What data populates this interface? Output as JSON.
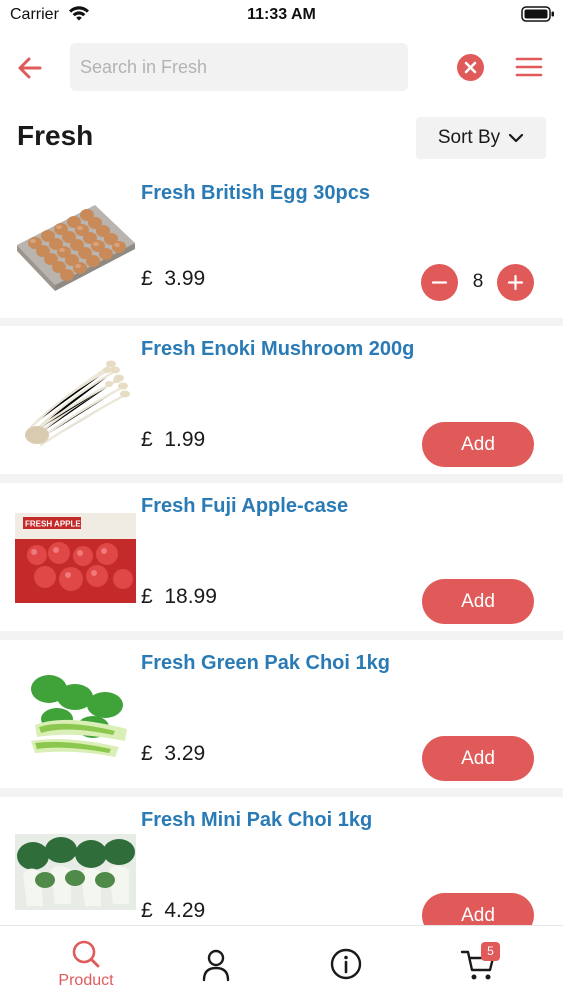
{
  "status_bar": {
    "carrier": "Carrier",
    "time": "11:33 AM"
  },
  "search": {
    "placeholder": "Search in Fresh",
    "value": ""
  },
  "page": {
    "title": "Fresh"
  },
  "sort": {
    "label": "Sort By"
  },
  "products": [
    {
      "name": "Fresh British Egg 30pcs",
      "currency": "£",
      "price": "3.99",
      "quantity": "8",
      "image": "egg-tray"
    },
    {
      "name": "Fresh Enoki Mushroom 200g",
      "currency": "£",
      "price": "1.99",
      "add_label": "Add",
      "image": "enoki-mushroom"
    },
    {
      "name": "Fresh Fuji Apple-case",
      "currency": "£",
      "price": "18.99",
      "add_label": "Add",
      "image": "apple-case",
      "image_text": "FRESH APPLE"
    },
    {
      "name": "Fresh Green Pak Choi 1kg",
      "currency": "£",
      "price": "3.29",
      "add_label": "Add",
      "image": "green-pak-choi"
    },
    {
      "name": "Fresh Mini Pak Choi 1kg",
      "currency": "£",
      "price": "4.29",
      "add_label": "Add",
      "image": "mini-pak-choi"
    }
  ],
  "tab_bar": {
    "product_label": "Product",
    "cart_count": "5",
    "icons": [
      "search-icon",
      "user-icon",
      "info-icon",
      "cart-icon"
    ]
  },
  "colors": {
    "accent": "#e05a5a",
    "product_name": "#2a7bb5",
    "background_gray": "#f3f3f3"
  }
}
